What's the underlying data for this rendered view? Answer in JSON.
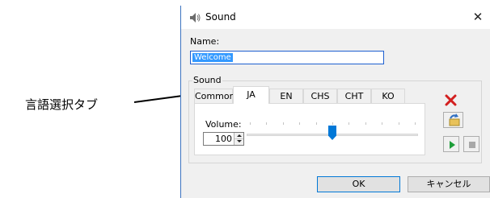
{
  "annotation": {
    "label": "言語選択タブ"
  },
  "window": {
    "title": "Sound",
    "close_glyph": "✕"
  },
  "name_field": {
    "label": "Name:",
    "value": "Welcome"
  },
  "sound_group": {
    "label": "Sound",
    "tabs": [
      {
        "label": "Common",
        "active": false
      },
      {
        "label": "JA",
        "active": true
      },
      {
        "label": "EN",
        "active": false
      },
      {
        "label": "CHS",
        "active": false
      },
      {
        "label": "CHT",
        "active": false
      },
      {
        "label": "KO",
        "active": false
      }
    ],
    "volume": {
      "label": "Volume:",
      "value": "100",
      "slider_level": 0.5
    }
  },
  "side_buttons": {
    "delete_icon": "red-x-icon",
    "reload_icon": "reload-file-icon",
    "play_icon": "play-icon",
    "stop_icon": "stop-icon"
  },
  "dialog_buttons": {
    "ok_label": "OK",
    "cancel_label": "キャンセル"
  },
  "colors": {
    "accent": "#0078d7",
    "selection": "#3399ff",
    "delete_red": "#d32020",
    "play_green": "#1e9e3a",
    "window_bg": "#f0f0f0"
  }
}
